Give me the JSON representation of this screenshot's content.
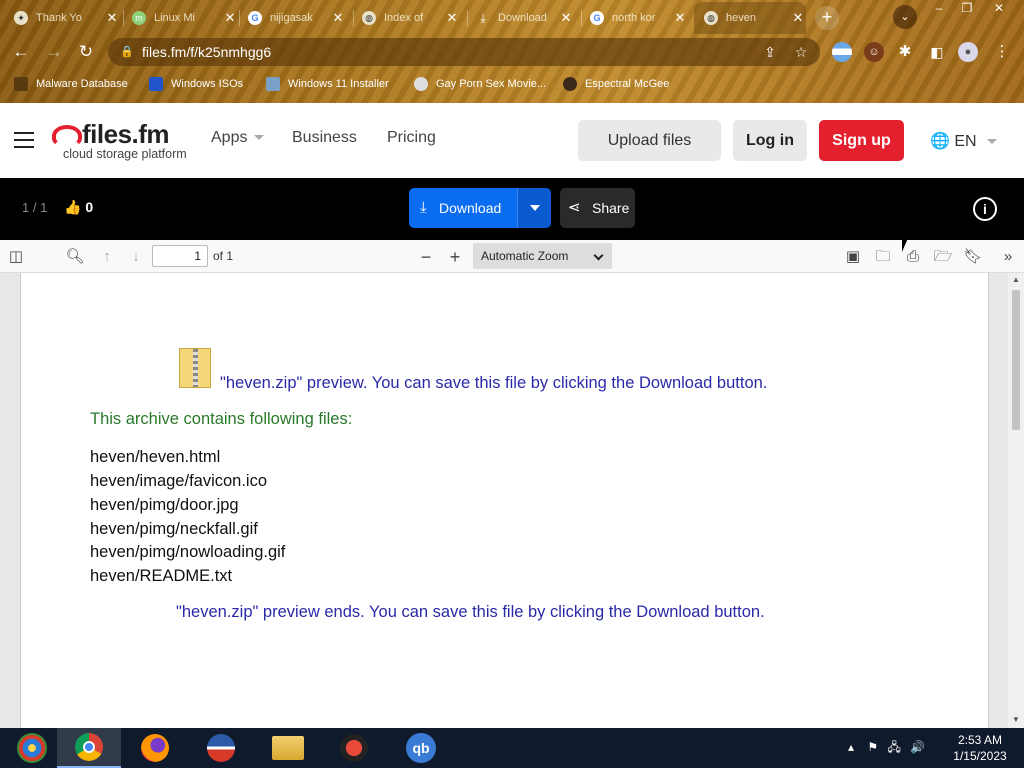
{
  "browser": {
    "tabs": [
      {
        "title": "Thank Yo",
        "icon": "tab-favicon-icon"
      },
      {
        "title": "Linux Mi",
        "icon": "linux-mint-icon"
      },
      {
        "title": "nijigasak",
        "icon": "google-icon"
      },
      {
        "title": "Index of",
        "icon": "globe-icon"
      },
      {
        "title": "Download",
        "icon": "download-icon"
      },
      {
        "title": "north kor",
        "icon": "google-icon"
      },
      {
        "title": "heven",
        "icon": "globe-icon",
        "active": true
      }
    ],
    "url": "files.fm/f/k25nmhgg6",
    "bookmarks": [
      {
        "label": "Malware Database"
      },
      {
        "label": "Windows ISOs"
      },
      {
        "label": "Windows 11 Installer"
      },
      {
        "label": "Gay Porn Sex Movie..."
      },
      {
        "label": "Espectral McGee"
      }
    ]
  },
  "site": {
    "logo_name": "files.fm",
    "logo_tagline": "cloud storage platform",
    "nav": {
      "apps": "Apps",
      "business": "Business",
      "pricing": "Pricing"
    },
    "upload_label": "Upload files",
    "login_label": "Log in",
    "signup_label": "Sign up",
    "lang": "EN",
    "accent_color": "#e5202e"
  },
  "viewer": {
    "counter": "1 / 1",
    "likes": "0",
    "download_label": "Download",
    "share_label": "Share"
  },
  "pdf_toolbar": {
    "page_value": "1",
    "page_total": "of 1",
    "zoom": "Automatic Zoom"
  },
  "document": {
    "preview_heading": "\"heven.zip\" preview. You can save this file by clicking the Download button.",
    "contains_label": "This archive contains following files:",
    "files": [
      "heven/heven.html",
      "heven/image/favicon.ico",
      "heven/pimg/door.jpg",
      "heven/pimg/neckfall.gif",
      "heven/pimg/nowloading.gif",
      "heven/README.txt"
    ],
    "preview_end": "\"heven.zip\" preview ends. You can save this file by clicking the Download button."
  },
  "taskbar": {
    "time": "2:53 AM",
    "date": "1/15/2023"
  }
}
